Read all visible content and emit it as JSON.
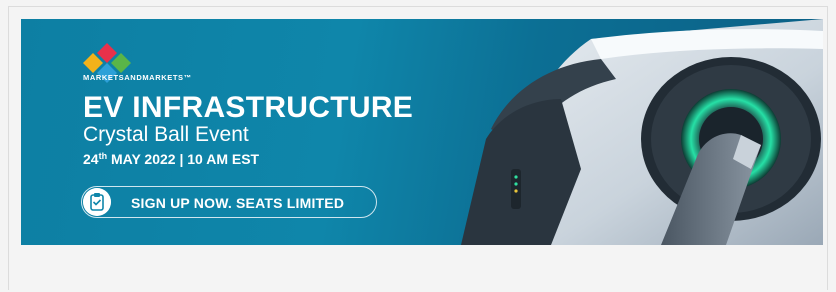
{
  "banner": {
    "brand": "MARKETSANDMARKETS™",
    "title": "EV INFRASTRUCTURE",
    "subtitle": "Crystal Ball Event",
    "date_day": "24",
    "date_suffix": "th",
    "date_rest": " MAY 2022 | 10 AM EST",
    "cta_label": "SIGN UP NOW. SEATS LIMITED",
    "cta_icon": "clipboard-icon",
    "logo_colors": [
      "#f2b21a",
      "#e8314b",
      "#5ab548",
      "#2da0d8"
    ],
    "image": "ev-charging-port-photo"
  }
}
